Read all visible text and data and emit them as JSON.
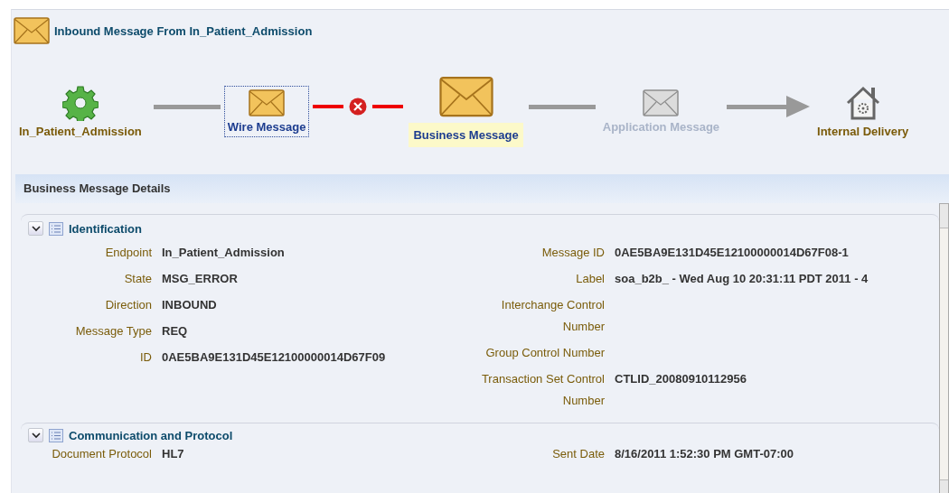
{
  "header": {
    "title": "Inbound Message From In_Patient_Admission"
  },
  "flow": [
    {
      "kind": "endpoint",
      "label": "In_Patient_Admission",
      "focused": false,
      "selected": false,
      "disabled": false
    },
    {
      "kind": "line"
    },
    {
      "kind": "message",
      "label": "Wire Message",
      "focused": true,
      "selected": false,
      "disabled": false
    },
    {
      "kind": "error"
    },
    {
      "kind": "message",
      "label": "Business Message",
      "focused": false,
      "selected": true,
      "disabled": false
    },
    {
      "kind": "line"
    },
    {
      "kind": "message",
      "label": "Application Message",
      "focused": false,
      "selected": false,
      "disabled": true
    },
    {
      "kind": "arrow"
    },
    {
      "kind": "delivery",
      "label": "Internal Delivery",
      "focused": false,
      "selected": false,
      "disabled": false
    }
  ],
  "details": {
    "title": "Business Message Details",
    "sections": [
      {
        "title": "Identification",
        "expanded": true,
        "left": [
          {
            "label": "Endpoint",
            "value": "In_Patient_Admission"
          },
          {
            "label": "State",
            "value": "MSG_ERROR"
          },
          {
            "label": "Direction",
            "value": "INBOUND"
          },
          {
            "label": "Message Type",
            "value": "REQ"
          },
          {
            "label": "ID",
            "value": "0AE5BA9E131D45E12100000014D67F09"
          }
        ],
        "right": [
          {
            "label": "Message ID",
            "value": "0AE5BA9E131D45E12100000014D67F08-1"
          },
          {
            "label": "Label",
            "value": "soa_b2b_ - Wed Aug 10 20:31:11 PDT 2011 - 4"
          },
          {
            "label": "Interchange Control Number"
          },
          {
            "label": "Group Control Number"
          },
          {
            "label": "Transaction Set Control Number",
            "value": "CTLID_20080910112956"
          }
        ]
      },
      {
        "title": "Communication and Protocol",
        "expanded": true,
        "left": [
          {
            "label": "Document Protocol",
            "value": "HL7"
          }
        ],
        "right": [
          {
            "label": "Sent Date",
            "value": "8/16/2011 1:52:30 PM GMT-07:00"
          }
        ]
      }
    ]
  }
}
